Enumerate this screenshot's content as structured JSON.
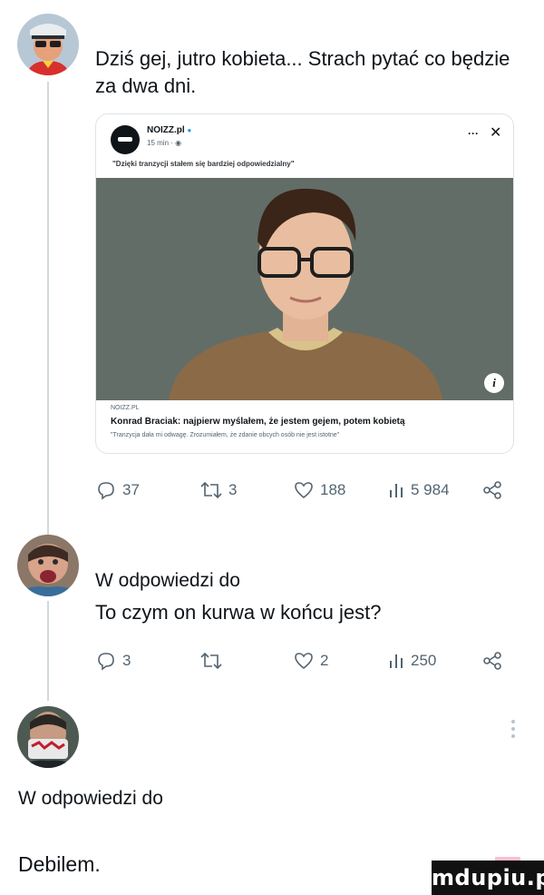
{
  "tweets": [
    {
      "text": "Dziś gej, jutro kobieta... Strach pytać co będzie za dwa dni.",
      "card": {
        "source_name": "NOIZZ.pl",
        "meta": "15 min · ",
        "quote": "\"Dzięki tranzycji stałem się bardziej odpowiedzialny\"",
        "link_source": "NOIZZ.PL",
        "link_title": "Konrad Braciak: najpierw myślałem, że jestem gejem, potem kobietą",
        "link_desc": "\"Tranzycja dała mi odwagę. Zrozumiałem, że zdanie obcych osób nie jest istotne\""
      },
      "actions": {
        "replies": "37",
        "retweets": "3",
        "likes": "188",
        "views": "5 984"
      }
    },
    {
      "reply_to": "W odpowiedzi do",
      "text": "To czym on kurwa w końcu jest?",
      "actions": {
        "replies": "3",
        "retweets": "",
        "likes": "2",
        "views": "250"
      }
    },
    {
      "reply_to": "W odpowiedzi do",
      "text": "Debilem."
    }
  ],
  "watermark": "mdupiu.pl",
  "icons": {
    "reply": "reply-icon",
    "retweet": "retweet-icon",
    "like": "heart-icon",
    "views": "views-chart-icon",
    "share": "share-icon"
  },
  "colors": {
    "text": "#0f1419",
    "muted": "#536471",
    "thread_line": "#cfd9de"
  }
}
